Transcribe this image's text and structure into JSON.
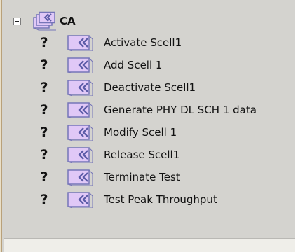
{
  "tree": {
    "root": {
      "label": "CA",
      "expander_state": "expanded",
      "icon": "stacked-folder-icon"
    },
    "items": [
      {
        "status": "?",
        "label": "Activate Scell1",
        "icon": "double-chevron-left-icon"
      },
      {
        "status": "?",
        "label": "Add Scell 1",
        "icon": "double-chevron-left-icon"
      },
      {
        "status": "?",
        "label": "Deactivate Scell1",
        "icon": "double-chevron-left-icon"
      },
      {
        "status": "?",
        "label": "Generate PHY DL SCH 1 data",
        "icon": "double-chevron-left-icon"
      },
      {
        "status": "?",
        "label": "Modify Scell 1",
        "icon": "double-chevron-left-icon"
      },
      {
        "status": "?",
        "label": "Release Scell1",
        "icon": "double-chevron-left-icon"
      },
      {
        "status": "?",
        "label": "Terminate Test",
        "icon": "double-chevron-left-icon"
      },
      {
        "status": "?",
        "label": "Test Peak Throughput",
        "icon": "double-chevron-left-icon"
      }
    ]
  },
  "colors": {
    "panel_background": "#d4d3cf",
    "icon_outline": "#7575b8",
    "icon_fill": "#e0c8f7",
    "icon_chevron": "#5a5aa6",
    "text": "#111111"
  }
}
